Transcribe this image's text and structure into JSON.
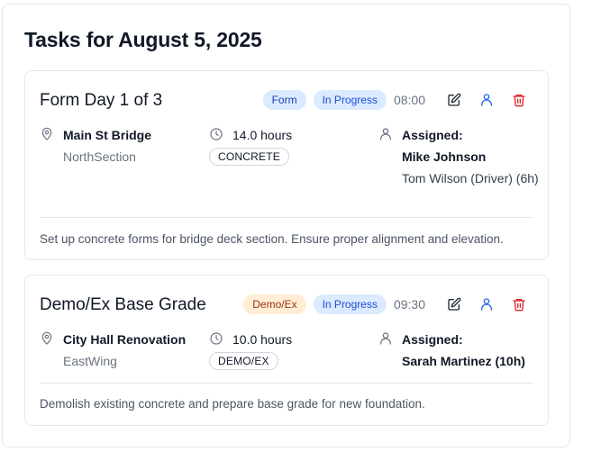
{
  "page": {
    "title": "Tasks for August 5, 2025"
  },
  "tasks": [
    {
      "title": "Form Day 1 of 3",
      "type_badge": "Form",
      "status_badge": "In Progress",
      "time": "08:00",
      "location": "Main St Bridge",
      "section": "NorthSection",
      "hours": "14.0 hours",
      "category": "CONCRETE",
      "assigned_label": "Assigned:",
      "assignees": [
        "Mike Johnson",
        "Tom Wilson (Driver) (6h)"
      ],
      "description": "Set up concrete forms for bridge deck section. Ensure proper alignment and elevation."
    },
    {
      "title": "Demo/Ex Base Grade",
      "type_badge": "Demo/Ex",
      "status_badge": "In Progress",
      "time": "09:30",
      "location": "City Hall Renovation",
      "section": "EastWing",
      "hours": "10.0 hours",
      "category": "DEMO/EX",
      "assigned_label": "Assigned:",
      "assignees": [
        "Sarah Martinez (10h)"
      ],
      "description": "Demolish existing concrete and prepare base grade for new foundation."
    }
  ],
  "icons": {
    "location": "map-pin-icon",
    "hours": "clock-icon",
    "assigned": "user-icon",
    "edit": "edit-icon",
    "assign": "assign-user-icon",
    "delete": "trash-icon"
  },
  "colors": {
    "form_badge_bg": "#dbeafe",
    "demo_badge_bg": "#ffedd5",
    "status_badge_bg": "#dbeafe",
    "delete_red": "#dc2626",
    "assign_blue": "#2563eb"
  }
}
